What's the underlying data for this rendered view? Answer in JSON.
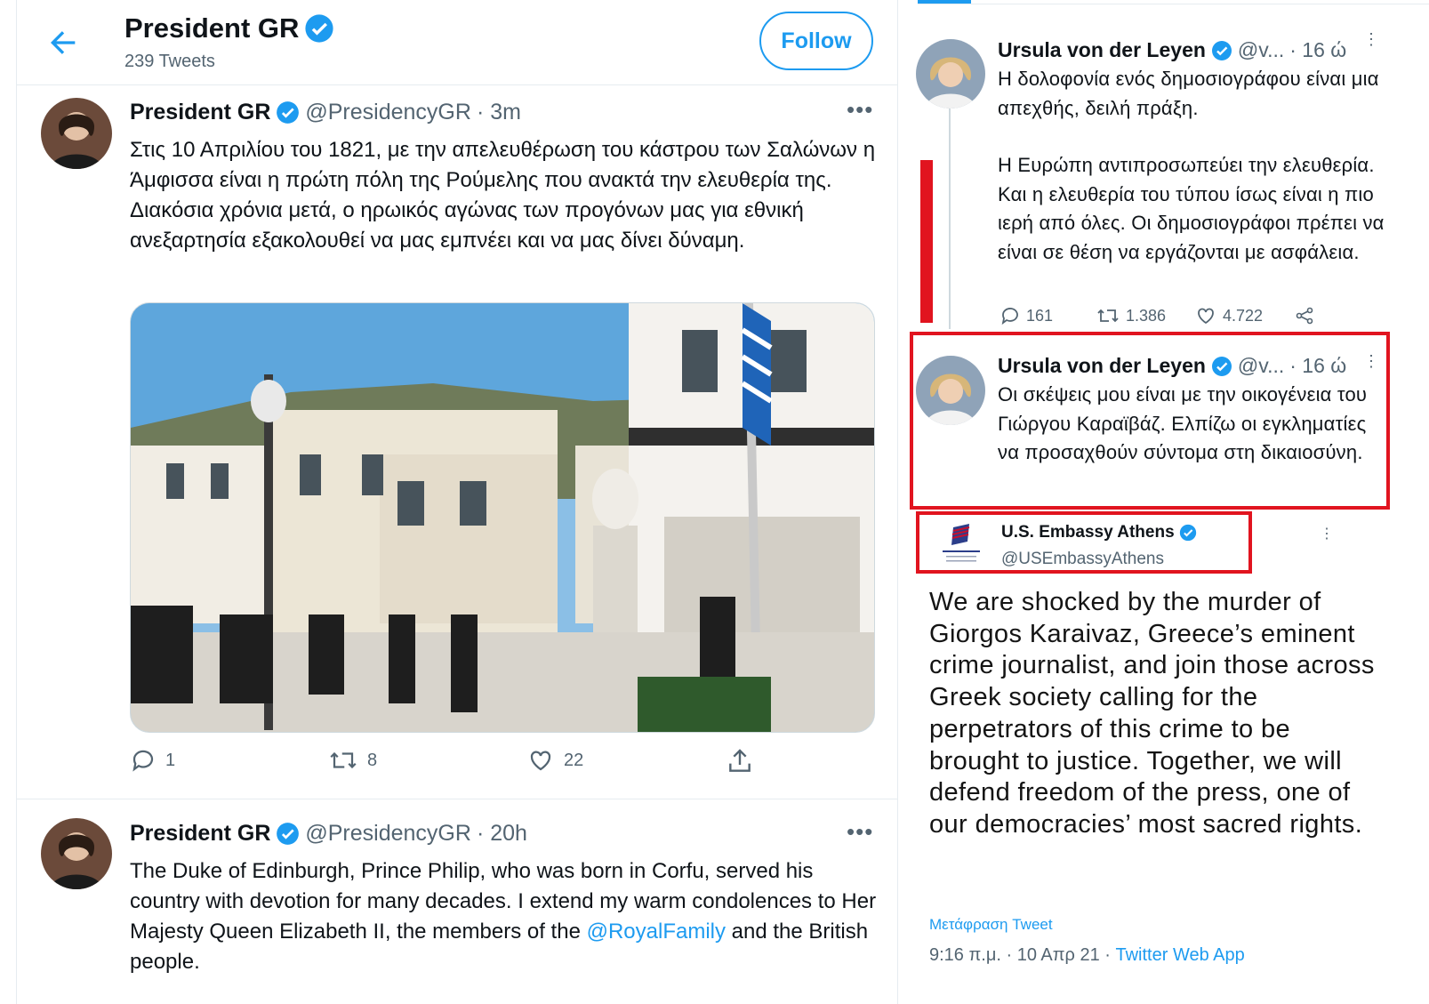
{
  "colors": {
    "accent": "#1d9bf0",
    "highlight_red": "#e1141f",
    "muted": "#536471"
  },
  "header": {
    "back_icon": "back-arrow-icon",
    "name": "President GR",
    "tweet_count": "239 Tweets",
    "follow_label": "Follow"
  },
  "tweets": [
    {
      "name": "President GR",
      "handle": "@PresidencyGR",
      "time": "· 3m",
      "text": "Στις 10 Απριλίου του 1821, με την απελευθέρωση του κάστρου των Σαλώνων η Άμφισσα είναι η πρώτη πόλη της Ρούμελης που ανακτά την ελευθερία της. Διακόσια χρόνια μετά, ο ηρωικός αγώνας των προγόνων μας για εθνική ανεξαρτησία εξακολουθεί να μας εμπνέει και να μας δίνει δύναμη.",
      "replies": "1",
      "retweets": "8",
      "likes": "22"
    },
    {
      "name": "President GR",
      "handle": "@PresidencyGR",
      "time": "· 20h",
      "text_before": "The Duke of Edinburgh, Prince Philip, who was born in Corfu, served his country with devotion for many decades. I extend my warm condolences to Her Majesty Queen Elizabeth II, the members of the ",
      "mention": "@RoyalFamily",
      "text_after": " and the British people."
    }
  ],
  "right": {
    "tweets": [
      {
        "name": "Ursula von der Leyen",
        "handle": "@v...",
        "time": "· 16 ώ",
        "para1": "Η δολοφονία ενός δημοσιογράφου είναι μια απεχθής, δειλή πράξη.",
        "para2": "Η Ευρώπη αντιπροσωπεύει την ελευθερία. Και η ελευθερία του τύπου ίσως είναι η πιο ιερή από όλες. Οι δημοσιογράφοι πρέπει να είναι σε θέση να εργάζονται με ασφάλεια.",
        "replies": "161",
        "retweets": "1.386",
        "likes": "4.722"
      },
      {
        "name": "Ursula von der Leyen",
        "handle": "@v...",
        "time": "· 16 ώ",
        "text": "Οι σκέψεις μου είναι με την οικογένεια του Γιώργου Καραϊβάζ. Ελπίζω οι εγκληματίες να προσαχθούν σύντομα στη δικαιοσύνη."
      }
    ],
    "embassy": {
      "name": "U.S. Embassy Athens",
      "handle": "@USEmbassyAthens",
      "text": "We are shocked by the murder of Giorgos Karaivaz, Greece’s eminent crime journalist, and join those across Greek society calling for the perpetrators of this crime to be brought to justice. Together, we will defend freedom of the press, one of our democracies’ most sacred rights.",
      "translate": "Μετάφραση Tweet",
      "timestamp": "9:16 π.μ. · 10 Απρ 21 · ",
      "app": "Twitter Web App"
    }
  }
}
